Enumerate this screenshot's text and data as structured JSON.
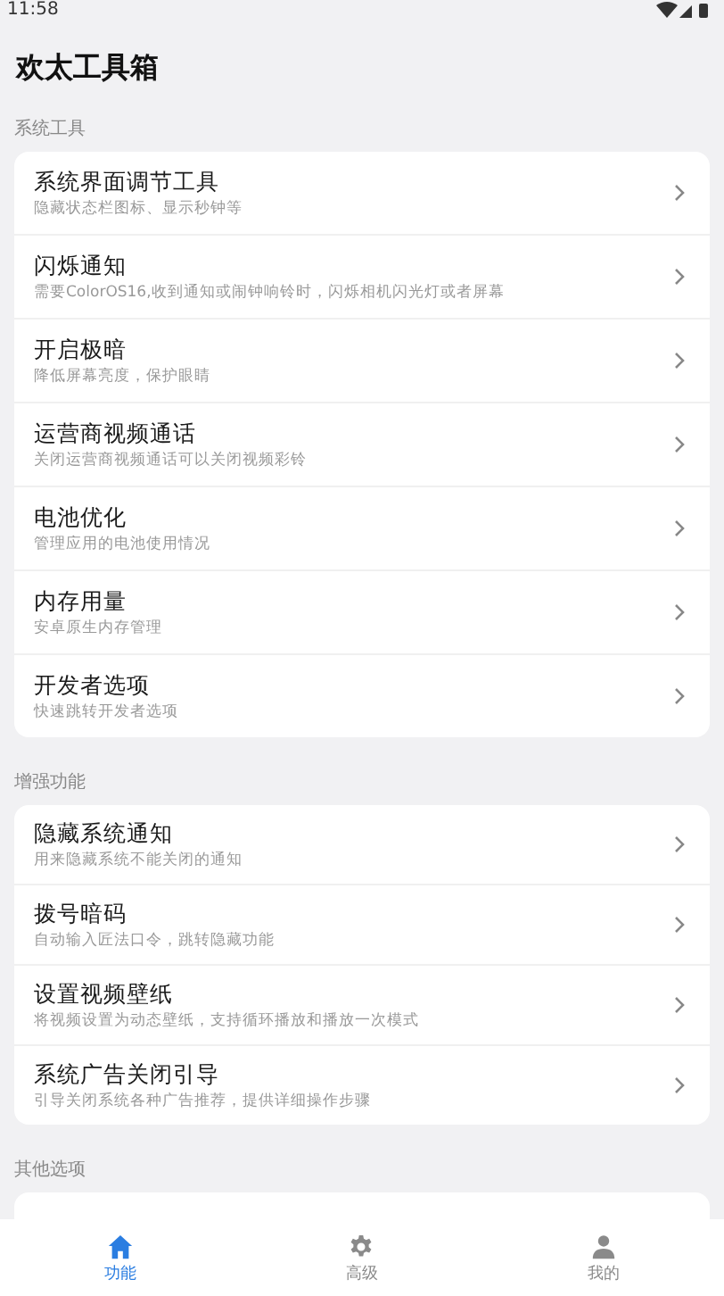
{
  "status_bar": {
    "time": "11:58"
  },
  "header": {
    "title": "欢太工具箱"
  },
  "sections": [
    {
      "title": "系统工具",
      "items": [
        {
          "title": "系统界面调节工具",
          "subtitle": "隐藏状态栏图标、显示秒钟等"
        },
        {
          "title": "闪烁通知",
          "subtitle": "需要ColorOS16,收到通知或闹钟响铃时，闪烁相机闪光灯或者屏幕"
        },
        {
          "title": "开启极暗",
          "subtitle": "降低屏幕亮度，保护眼睛"
        },
        {
          "title": "运营商视频通话",
          "subtitle": "关闭运营商视频通话可以关闭视频彩铃"
        },
        {
          "title": "电池优化",
          "subtitle": "管理应用的电池使用情况"
        },
        {
          "title": "内存用量",
          "subtitle": "安卓原生内存管理"
        },
        {
          "title": "开发者选项",
          "subtitle": "快速跳转开发者选项"
        }
      ]
    },
    {
      "title": "增强功能",
      "items": [
        {
          "title": "隐藏系统通知",
          "subtitle": "用来隐藏系统不能关闭的通知"
        },
        {
          "title": "拨号暗码",
          "subtitle": "自动输入匠法口令，跳转隐藏功能"
        },
        {
          "title": "设置视频壁纸",
          "subtitle": "将视频设置为动态壁纸，支持循环播放和播放一次模式"
        },
        {
          "title": "系统广告关闭引导",
          "subtitle": "引导关闭系统各种广告推荐，提供详细操作步骤"
        }
      ]
    },
    {
      "title": "其他选项"
    }
  ],
  "bottom_nav": [
    {
      "kind": "home",
      "label": "功能",
      "selected": true
    },
    {
      "kind": "gear",
      "label": "高级",
      "selected": false
    },
    {
      "kind": "person",
      "label": "我的",
      "selected": false
    }
  ]
}
